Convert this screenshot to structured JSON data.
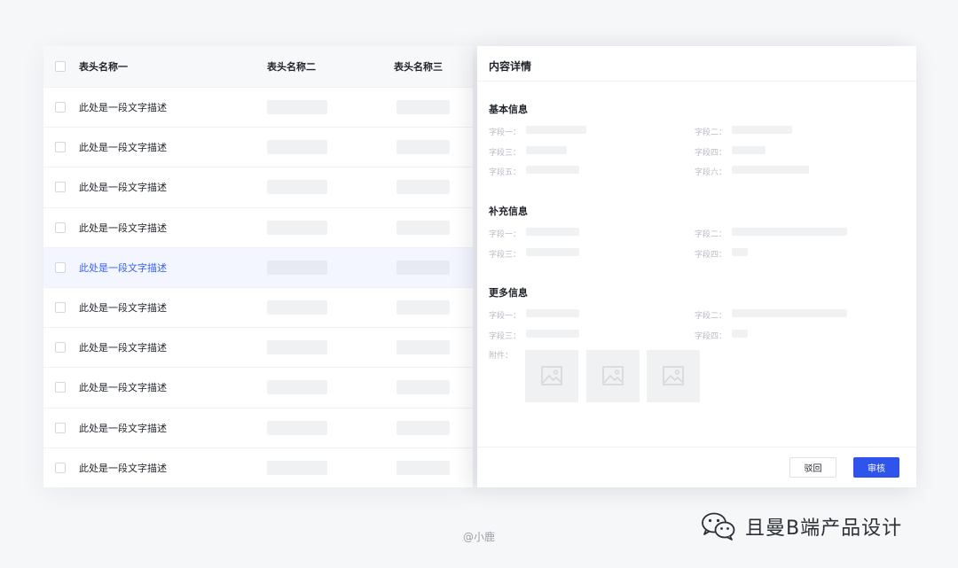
{
  "table": {
    "headers": [
      "表头名称一",
      "表头名称二",
      "表头名称三"
    ],
    "rows": [
      {
        "text": "此处是一段文字描述"
      },
      {
        "text": "此处是一段文字描述"
      },
      {
        "text": "此处是一段文字描述"
      },
      {
        "text": "此处是一段文字描述"
      },
      {
        "text": "此处是一段文字描述"
      },
      {
        "text": "此处是一段文字描述"
      },
      {
        "text": "此处是一段文字描述"
      },
      {
        "text": "此处是一段文字描述"
      },
      {
        "text": "此处是一段文字描述"
      },
      {
        "text": "此处是一段文字描述"
      }
    ],
    "selected_row_index": 4
  },
  "drawer": {
    "title": "内容详情",
    "sections": [
      {
        "title": "基本信息",
        "fields": [
          "字段一：",
          "字段二：",
          "字段三：",
          "字段四：",
          "字段五：",
          "字段六："
        ]
      },
      {
        "title": "补充信息",
        "fields": [
          "字段一：",
          "字段二：",
          "字段三：",
          "字段四："
        ]
      },
      {
        "title": "更多信息",
        "fields": [
          "字段一：",
          "字段二：",
          "字段三：",
          "字段四："
        ],
        "attachment_label": "附件："
      }
    ],
    "reject_label": "驳回",
    "approve_label": "审核"
  },
  "credit": "@小鹿",
  "watermark": "且曼B端产品设计",
  "colors": {
    "primary": "#2f54eb",
    "selected_text": "#3660f0",
    "selected_row_bg": "#f3f6fe",
    "placeholder": "#f0f1f3"
  }
}
